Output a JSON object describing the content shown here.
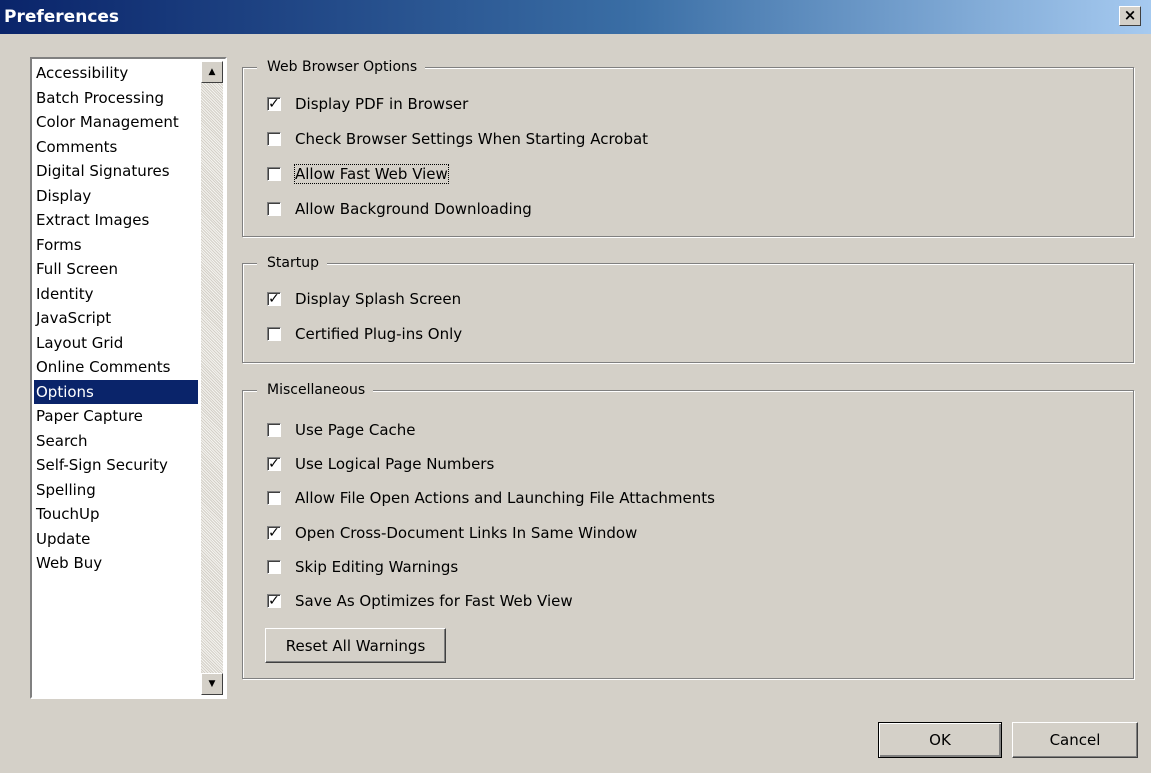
{
  "window": {
    "title": "Preferences",
    "close_label": "×"
  },
  "sidebar": {
    "items": [
      {
        "label": "Accessibility"
      },
      {
        "label": "Batch Processing"
      },
      {
        "label": "Color Management"
      },
      {
        "label": "Comments"
      },
      {
        "label": "Digital Signatures"
      },
      {
        "label": "Display"
      },
      {
        "label": "Extract Images"
      },
      {
        "label": "Forms"
      },
      {
        "label": "Full Screen"
      },
      {
        "label": "Identity"
      },
      {
        "label": "JavaScript"
      },
      {
        "label": "Layout Grid"
      },
      {
        "label": "Online Comments"
      },
      {
        "label": "Options",
        "selected": true
      },
      {
        "label": "Paper Capture"
      },
      {
        "label": "Search"
      },
      {
        "label": "Self-Sign Security"
      },
      {
        "label": "Spelling"
      },
      {
        "label": "TouchUp"
      },
      {
        "label": "Update"
      },
      {
        "label": "Web Buy"
      }
    ],
    "scroll_up_icon": "▲",
    "scroll_down_icon": "▼"
  },
  "web_browser_options": {
    "legend": "Web Browser Options",
    "options": [
      {
        "label": "Display PDF in Browser",
        "checked": true
      },
      {
        "label": "Check Browser Settings When Starting Acrobat",
        "checked": false
      },
      {
        "label": "Allow Fast Web View",
        "checked": false,
        "focused": true
      },
      {
        "label": "Allow Background Downloading",
        "checked": false
      }
    ]
  },
  "startup": {
    "legend": "Startup",
    "options": [
      {
        "label": "Display Splash Screen",
        "checked": true
      },
      {
        "label": "Certified Plug-ins Only",
        "checked": false
      }
    ]
  },
  "miscellaneous": {
    "legend": "Miscellaneous",
    "options": [
      {
        "label": "Use Page Cache",
        "checked": false
      },
      {
        "label": "Use Logical Page Numbers",
        "checked": true
      },
      {
        "label": "Allow File Open Actions and Launching File Attachments",
        "checked": false
      },
      {
        "label": "Open Cross-Document Links In Same Window",
        "checked": true
      },
      {
        "label": "Skip Editing Warnings",
        "checked": false
      },
      {
        "label": "Save As Optimizes for Fast Web View",
        "checked": true
      }
    ],
    "reset_label": "Reset All Warnings"
  },
  "footer": {
    "ok_label": "OK",
    "cancel_label": "Cancel"
  },
  "check_mark": "✓"
}
